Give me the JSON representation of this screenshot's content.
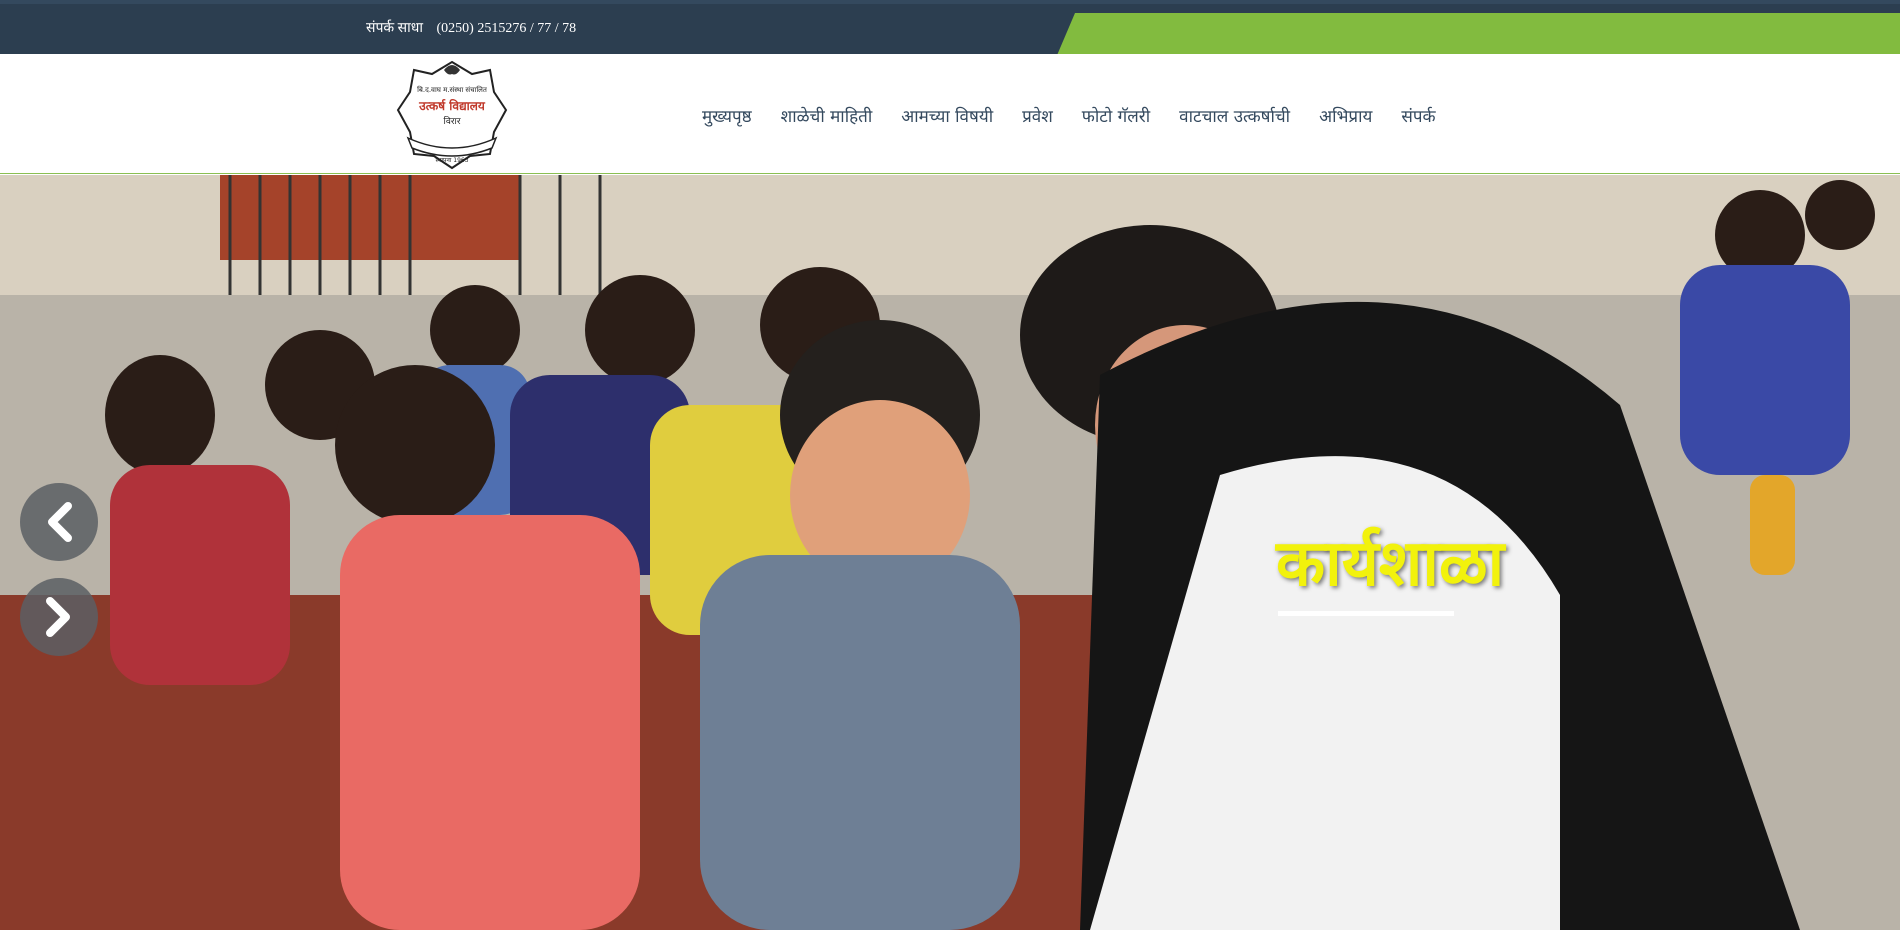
{
  "topbar": {
    "contact_label": "संपर्क साधा",
    "phone": "(0250) 2515276 / 77 / 78"
  },
  "logo": {
    "line1": "बि.द.वाघ म.संस्था संचालित",
    "name": "उत्कर्ष विद्यालय",
    "place": "विरार",
    "est": "स्थापना 1963"
  },
  "nav": {
    "items": [
      "मुख्यपृष्ठ",
      "शाळेची माहिती",
      "आमच्या विषयी",
      "प्रवेश",
      "फोटो गॅलरी",
      "वाटचाल उत्कर्षाची",
      "अभिप्राय",
      "संपर्क"
    ]
  },
  "hero": {
    "caption": "कार्यशाळा",
    "prev_icon": "chevron-left-icon",
    "next_icon": "chevron-right-icon"
  },
  "colors": {
    "topbar": "#2c3e50",
    "accent_green": "#82bb3f",
    "caption": "#f2f20c",
    "nav_text": "#34495e"
  }
}
